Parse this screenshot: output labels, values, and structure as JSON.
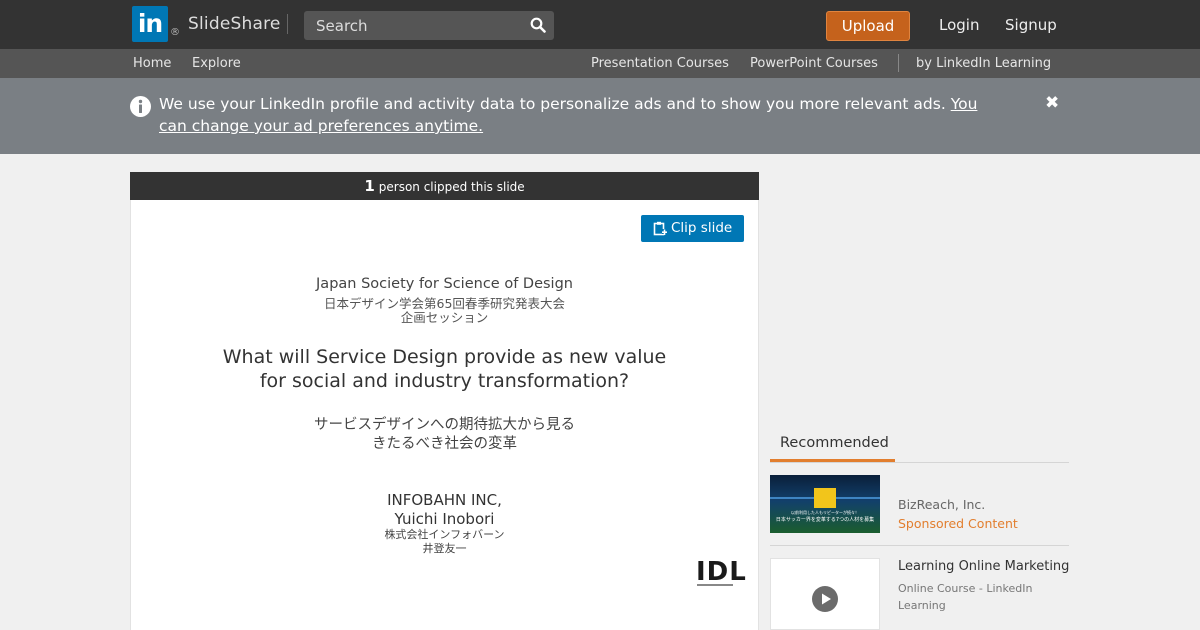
{
  "header": {
    "logo_mark": "in",
    "logo_reg": "®",
    "brand": "SlideShare",
    "search_placeholder": "Search",
    "upload_label": "Upload",
    "login_label": "Login",
    "signup_label": "Signup"
  },
  "subnav": {
    "home": "Home",
    "explore": "Explore",
    "presentation_courses": "Presentation Courses",
    "powerpoint_courses": "PowerPoint Courses",
    "by_linkedin": "by LinkedIn Learning"
  },
  "notice": {
    "text": "We use your LinkedIn profile and activity data to personalize ads and to show you more relevant ads. ",
    "link": "You can change your ad preferences anytime.",
    "close": "✖"
  },
  "clip": {
    "count": "1",
    "text": "person clipped this slide",
    "button": "Clip slide"
  },
  "slide": {
    "society": "Japan Society for Science of Design",
    "jp_conf": "日本デザイン学会第65回春季研究発表大会",
    "jp_session": "企画セッション",
    "title_line1": "What will Service Design provide as new value",
    "title_line2": "for social and industry transformation?",
    "sub_line1": "サービスデザインへの期待拡大から見る",
    "sub_line2": "きたるべき社会の変革",
    "company": "INFOBAHN INC,",
    "author": "Yuichi Inobori",
    "company_jp": "株式会社インフォバーン",
    "author_jp": "井登友一",
    "logo": "IDL"
  },
  "recommended": {
    "tab": "Recommended",
    "items": [
      {
        "company": "BizReach, Inc.",
        "tag": "Sponsored Content",
        "thumb_text1": "以前利用した人もリピーターが続々！",
        "thumb_text2": "日本サッカー界を変革する7つの人材を募集"
      },
      {
        "title": "Learning Online Marketing",
        "sub1": "Online Course - LinkedIn",
        "sub2": "Learning"
      }
    ]
  },
  "colors": {
    "topbar": "#333333",
    "subnav": "#555555",
    "notice": "#7a7f84",
    "upload": "#c5621c",
    "linkedin_blue": "#0077b5",
    "accent_orange": "#e27e2e"
  }
}
